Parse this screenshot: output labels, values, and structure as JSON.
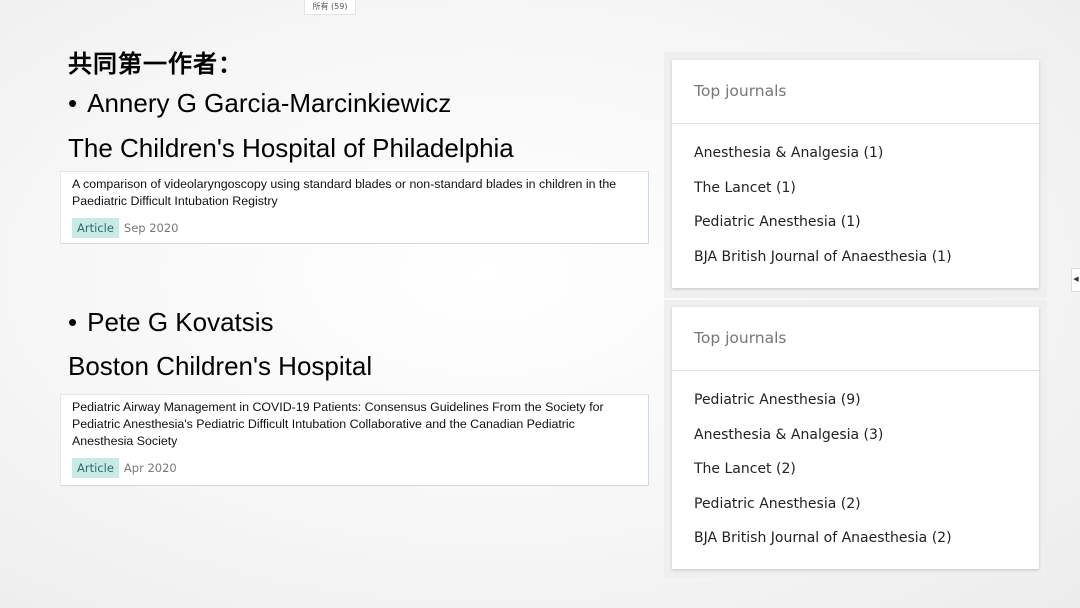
{
  "top_tab": {
    "label": "所有 (59)"
  },
  "heading": "共同第一作者：",
  "authors": [
    {
      "bullet": "•",
      "name": "Annery G Garcia-Marcinkiewicz",
      "affiliation": "The Children's Hospital of Philadelphia",
      "article": {
        "title": "A comparison of videolaryngoscopy using standard blades or non-standard blades in children in the Paediatric Difficult Intubation Registry",
        "type": "Article",
        "date": "Sep 2020"
      },
      "journals_panel": {
        "title": "Top journals",
        "items": [
          "Anesthesia & Analgesia (1)",
          "The Lancet (1)",
          "Pediatric Anesthesia (1)",
          "BJA British Journal of Anaesthesia (1)"
        ]
      }
    },
    {
      "bullet": "•",
      "name": "Pete G Kovatsis",
      "affiliation": "Boston Children's Hospital",
      "article": {
        "title": "Pediatric Airway Management in COVID-19 Patients: Consensus Guidelines From the Society for Pediatric Anesthesia's Pediatric Difficult Intubation Collaborative and the Canadian Pediatric Anesthesia Society",
        "type": "Article",
        "date": "Apr 2020"
      },
      "journals_panel": {
        "title": "Top journals",
        "items": [
          "Pediatric Anesthesia (9)",
          "Anesthesia & Analgesia (3)",
          "The Lancet (2)",
          "Pediatric Anesthesia (2)",
          "BJA British Journal of Anaesthesia (2)"
        ]
      }
    }
  ],
  "icons": {
    "edge_toggle": "caret-left-icon"
  }
}
